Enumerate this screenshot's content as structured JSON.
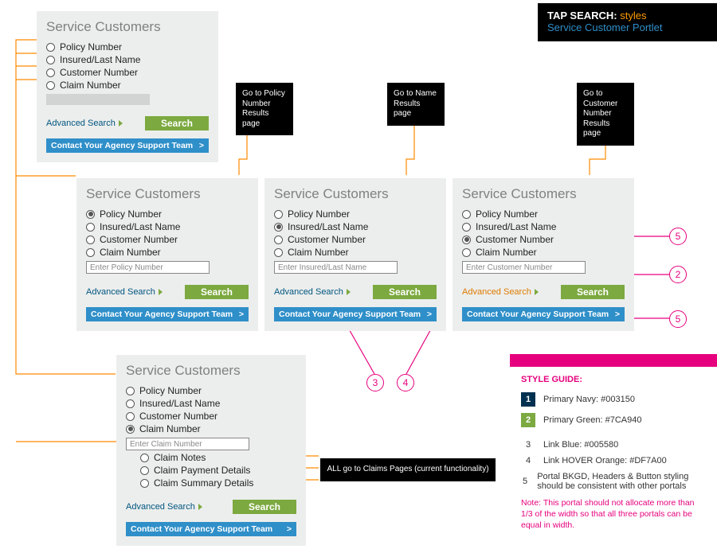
{
  "header": {
    "prefix": "TAP SEARCH:",
    "suffix": "styles",
    "subtitle": "Service Customer Portlet"
  },
  "portlet_title": "Service Customers",
  "radios": {
    "policy": "Policy Number",
    "insured": "Insured/Last Name",
    "customer": "Customer Number",
    "claim": "Claim Number"
  },
  "placeholders": {
    "policy": "Enter Policy Number",
    "insured": "Enter Insured/Last Name",
    "customer": "Enter Customer Number",
    "claim": "Enter Claim Number"
  },
  "claim_sub": {
    "notes": "Claim Notes",
    "payment": "Claim Payment Details",
    "summary": "Claim Summary Details"
  },
  "advanced": "Advanced Search",
  "search_btn": "Search",
  "contact_btn": "Contact Your Agency Support Team",
  "chevron": ">",
  "callouts": {
    "policy_page": "Go to Policy Number Results page",
    "name_page": "Go to Name Results page",
    "customer_page": "Go to Customer Number Results page",
    "claims_page": "ALL go to Claims Pages (current functionality)"
  },
  "style_guide": {
    "title": "STYLE GUIDE:",
    "items": [
      {
        "n": "1",
        "swatch": "navy",
        "text": "Primary Navy: #003150"
      },
      {
        "n": "2",
        "swatch": "green",
        "text": "Primary Green: #7CA940"
      },
      {
        "n": "3",
        "swatch": "",
        "text": "Link Blue: #005580"
      },
      {
        "n": "4",
        "swatch": "",
        "text": "Link HOVER Orange: #DF7A00"
      },
      {
        "n": "5",
        "swatch": "",
        "text": "Portal BKGD, Headers & Button styling should be consistent with other portals"
      }
    ],
    "note": "Note:  This portal should not allocate more than 1/3 of the width so that all three portals can be equal in width."
  },
  "anno": {
    "c2": "2",
    "c3": "3",
    "c4": "4",
    "c5a": "5",
    "c5b": "5"
  }
}
